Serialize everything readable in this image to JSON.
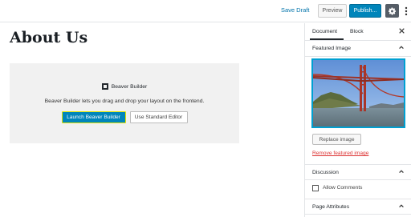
{
  "topbar": {
    "save_draft": "Save Draft",
    "preview": "Preview",
    "publish": "Publish...",
    "settings_icon": "gear-icon",
    "more_icon": "vertical-ellipsis-icon"
  },
  "editor": {
    "title": "About Us",
    "beaver": {
      "name": "Beaver Builder",
      "description": "Beaver Builder lets you drag and drop your layout on the frontend.",
      "launch_label": "Launch Beaver Builder",
      "standard_label": "Use Standard Editor"
    }
  },
  "sidebar": {
    "tabs": [
      "Document",
      "Block"
    ],
    "active_tab": "Document",
    "close_icon": "close-icon",
    "featured_image": {
      "label": "Featured Image",
      "replace_label": "Replace image",
      "remove_label": "Remove featured image"
    },
    "discussion": {
      "label": "Discussion",
      "allow_comments_label": "Allow Comments",
      "allow_comments_checked": false
    },
    "page_attributes": {
      "label": "Page Attributes"
    }
  },
  "colors": {
    "accent": "#0085ba",
    "link": "#0073aa",
    "danger": "#dc3232",
    "focus_outline": "#00a0d2"
  }
}
